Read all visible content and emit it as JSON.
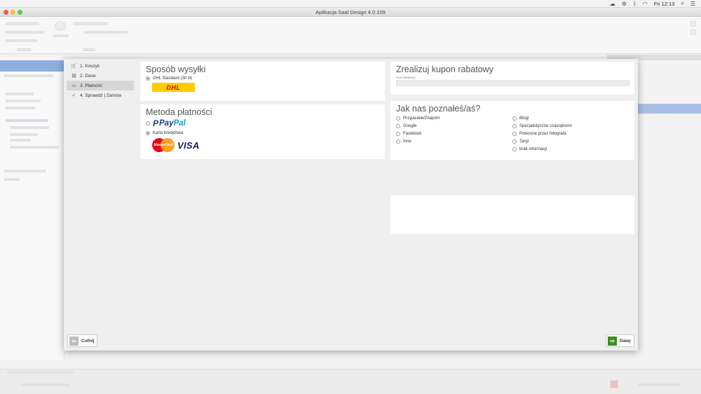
{
  "menubar": {
    "apple": "",
    "clock": "Fri 12:13",
    "icons": [
      "cloud-icon",
      "gear-icon",
      "bluetooth-icon",
      "wifi-icon",
      "search-icon",
      "list-icon"
    ]
  },
  "window": {
    "title": "Aplikacja Saal Design 4.0.109"
  },
  "steps": [
    {
      "label": "1. Koszyk",
      "icon": "cart-icon"
    },
    {
      "label": "2. Dane",
      "icon": "data-icon"
    },
    {
      "label": "3. Płatność",
      "icon": "payment-icon"
    },
    {
      "label": "4. Sprawdź | Zamów",
      "icon": "check-icon"
    }
  ],
  "shipping": {
    "title": "Sposób wysyłki",
    "option_label": "DHL Standard (30 zł)",
    "logo_text": "DHL"
  },
  "payment": {
    "title": "Metoda płatności",
    "paypal_text_1": "Pay",
    "paypal_text_2": "Pal",
    "card_label": "Karta kredytowa",
    "mastercard_text": "MasterCard",
    "visa_text": "VISA"
  },
  "coupon": {
    "title": "Zrealizuj kupon rabatowy",
    "field_label": "Kod rabatowy:",
    "value": ""
  },
  "how": {
    "title": "Jak nas poznałeś/aś?",
    "left": [
      "Przyjaciele/Znajomi",
      "Google",
      "Facebook",
      "Inne"
    ],
    "right": [
      "Blogi",
      "Specjalistyczne czasopismo",
      "Polecone przez fotografa",
      "Targi",
      "brak informacji"
    ]
  },
  "buttons": {
    "back": "Cofnij",
    "next": "Dalej"
  },
  "colors": {
    "next_green": "#3e8e1e",
    "dhl_yellow": "#ffcc00",
    "dhl_red": "#d40511"
  }
}
